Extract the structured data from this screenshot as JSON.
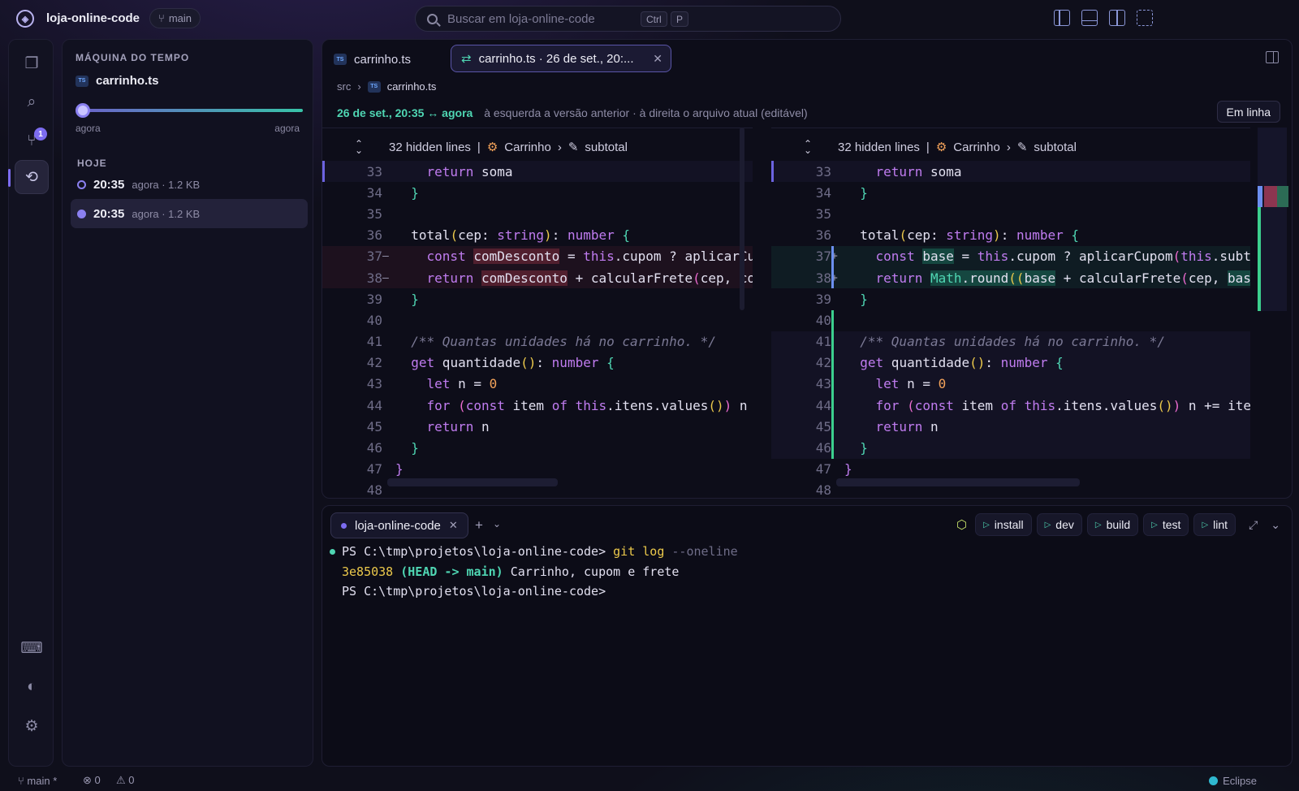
{
  "app": {
    "title": "loja-online-code",
    "branch": "main"
  },
  "search": {
    "placeholder": "Buscar em loja-online-code",
    "key1": "Ctrl",
    "key2": "P"
  },
  "activity": {
    "badge": "1"
  },
  "timemachine": {
    "title": "MÁQUINA DO TEMPO",
    "file": "carrinho.ts",
    "slider_left": "agora",
    "slider_right": "agora",
    "slider_position": 0,
    "section": "HOJE",
    "snapshots": [
      {
        "time": "20:35",
        "meta": "agora · 1.2 KB"
      },
      {
        "time": "20:35",
        "meta": "agora · 1.2 KB"
      }
    ]
  },
  "editor": {
    "tab1": "carrinho.ts",
    "tab2": "carrinho.ts · 26 de set., 20:...",
    "crumb_dir": "src",
    "crumb_file": "carrinho.ts",
    "info_range": "26 de set., 20:35 ↔ agora",
    "info_desc": "à esquerda a versão anterior · à direita o arquivo atual (editável)",
    "inline_button": "Em linha",
    "hidden_lines": "32 hidden lines",
    "scope_class": "Carrinho",
    "scope_member": "subtotal"
  },
  "terminal": {
    "tab": "loja-online-code",
    "tasks": [
      "install",
      "dev",
      "build",
      "test",
      "lint"
    ],
    "prompt": "PS C:\\tmp\\projetos\\loja-online-code>",
    "cmd": "git log",
    "cmd_flag": "--oneline",
    "hash": "3e85038",
    "head": "(HEAD -> main)",
    "commit_msg": "Carrinho, cupom e frete"
  },
  "status": {
    "branch": "main *",
    "errors": "0",
    "warnings": "0",
    "theme": "Eclipse"
  },
  "colors": {
    "accent": "#7c6cf0",
    "teal": "#4fd6b3",
    "deleted": "#dc465a",
    "added": "#28c896"
  }
}
